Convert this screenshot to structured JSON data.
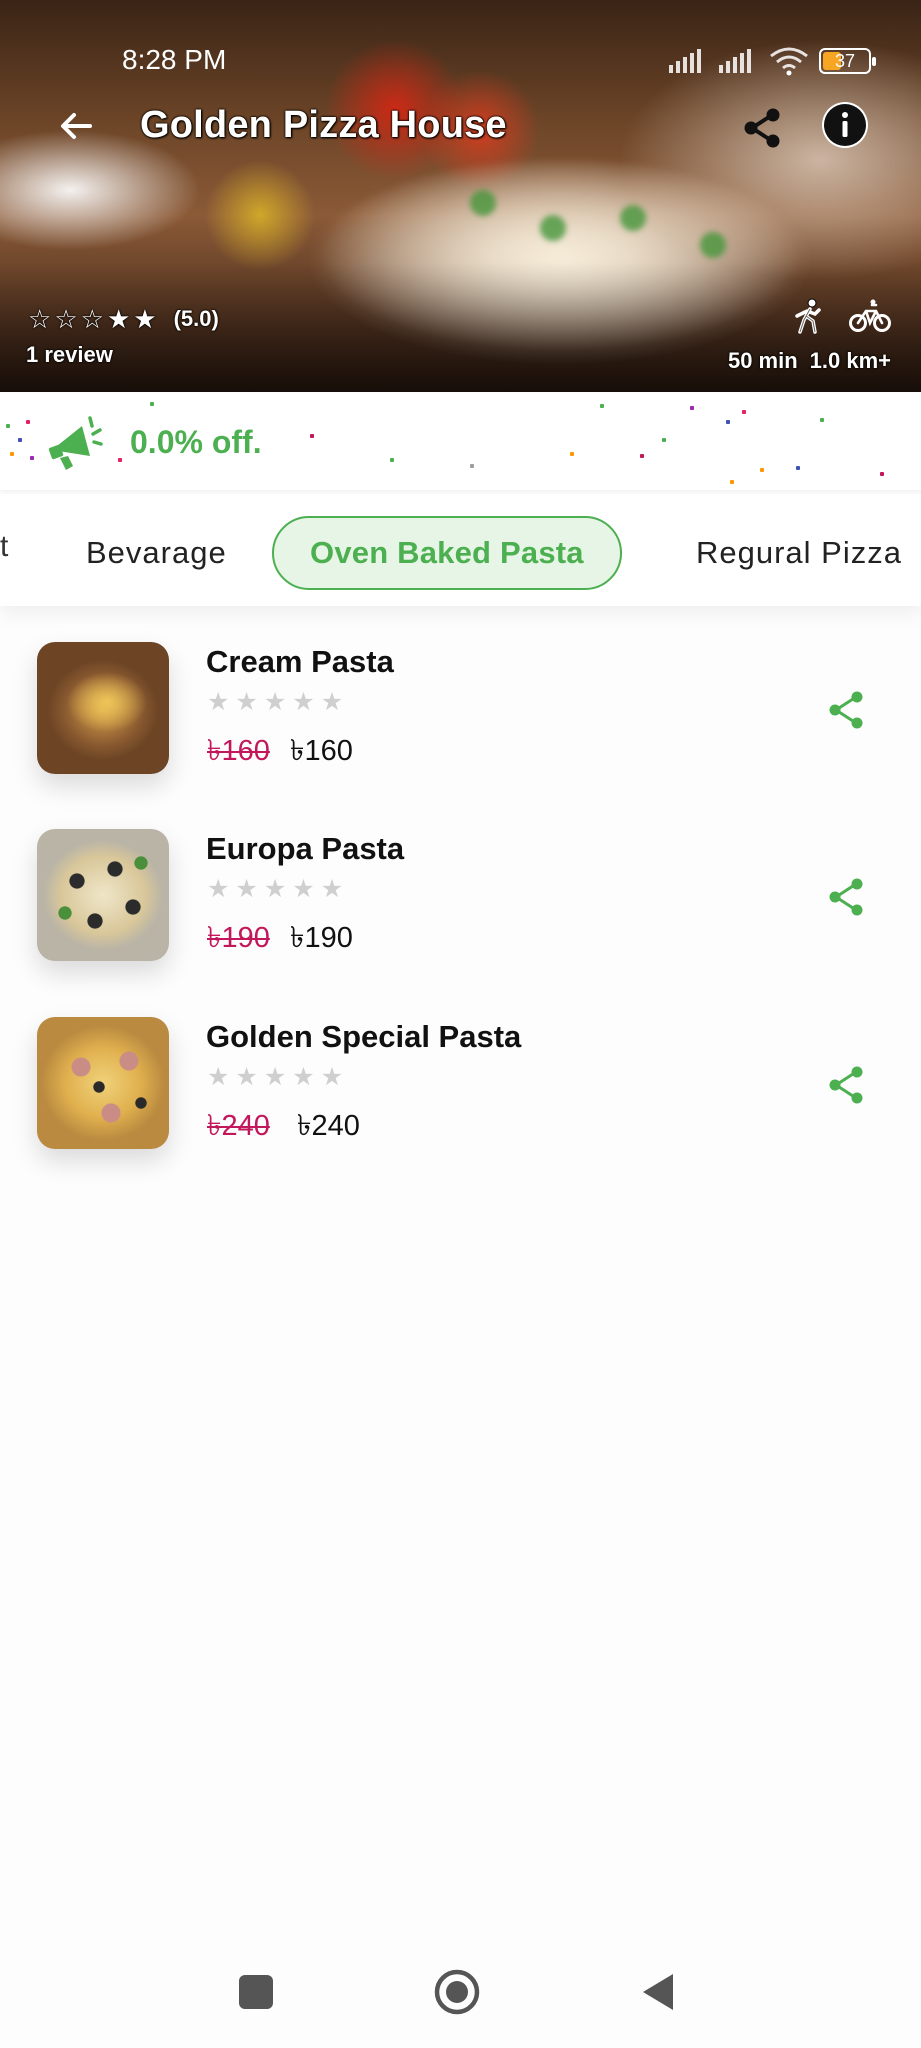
{
  "status_bar": {
    "time": "8:28 PM",
    "battery": "37"
  },
  "header": {
    "title": "Golden Pizza House"
  },
  "restaurant": {
    "rating": "(5.0)",
    "reviews": "1 review",
    "delivery_time": "50 min",
    "distance": "1.0 km+"
  },
  "discount": {
    "text": "0.0% off."
  },
  "categories": {
    "partial": "t",
    "items": [
      "Bevarage",
      "Oven Baked Pasta",
      "Regural Pizza"
    ],
    "active": "Oven Baked Pasta"
  },
  "products": [
    {
      "name": "Cream Pasta",
      "old_price": "৳160",
      "price": "৳160",
      "rating_stars": 0
    },
    {
      "name": "Europa Pasta",
      "old_price": "৳190",
      "price": "৳190",
      "rating_stars": 0
    },
    {
      "name": "Golden Special Pasta",
      "old_price": "৳240",
      "price": "৳240",
      "rating_stars": 0
    }
  ],
  "colors": {
    "accent": "#4caf50",
    "accent_bg": "#e7f5e6",
    "old_price": "#c2185b",
    "star_empty": "#cfcfcf"
  },
  "icons": [
    "back-arrow-icon",
    "share-icon",
    "info-icon",
    "star-icon",
    "walking-icon",
    "bicycle-icon",
    "megaphone-icon",
    "stop-icon",
    "home-icon",
    "back-triangle-icon"
  ]
}
